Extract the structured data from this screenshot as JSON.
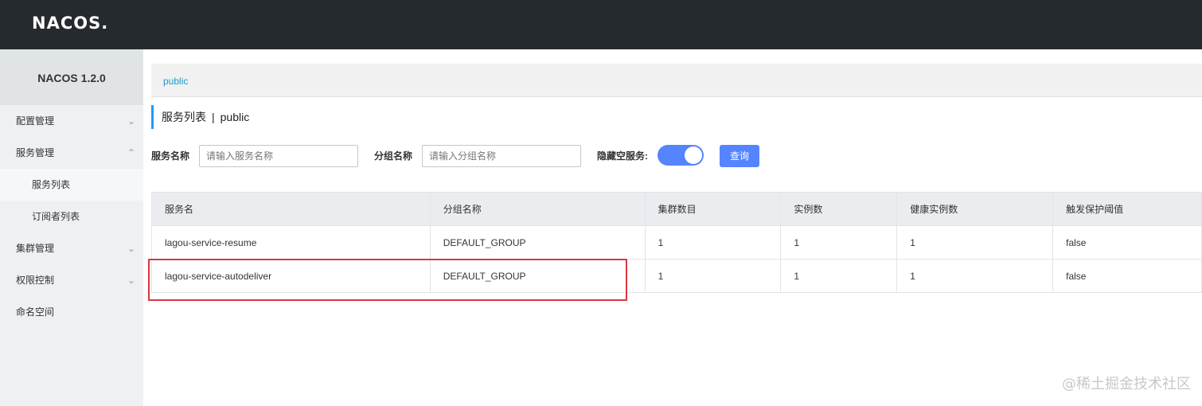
{
  "app": {
    "logo": "NACOS.",
    "version": "NACOS 1.2.0"
  },
  "sidebar": {
    "items": [
      {
        "label": "配置管理",
        "chevron": "chevron-down"
      },
      {
        "label": "服务管理",
        "chevron": "chevron-up"
      },
      {
        "label": "服务列表"
      },
      {
        "label": "订阅者列表"
      },
      {
        "label": "集群管理",
        "chevron": "chevron-down"
      },
      {
        "label": "权限控制",
        "chevron": "chevron-down"
      },
      {
        "label": "命名空间"
      }
    ]
  },
  "breadcrumb": {
    "namespace": "public"
  },
  "page": {
    "title": "服务列表",
    "separator": "|",
    "namespace": "public"
  },
  "filters": {
    "service_name_label": "服务名称",
    "service_name_placeholder": "请输入服务名称",
    "group_name_label": "分组名称",
    "group_name_placeholder": "请输入分组名称",
    "hide_empty_label": "隐藏空服务:",
    "hide_empty_on": true,
    "query_button": "查询"
  },
  "table": {
    "headers": [
      "服务名",
      "分组名称",
      "集群数目",
      "实例数",
      "健康实例数",
      "触发保护阈值"
    ],
    "rows": [
      [
        "lagou-service-resume",
        "DEFAULT_GROUP",
        "1",
        "1",
        "1",
        "false"
      ],
      [
        "lagou-service-autodeliver",
        "DEFAULT_GROUP",
        "1",
        "1",
        "1",
        "false"
      ]
    ]
  },
  "watermark": "@稀土掘金技术社区",
  "colors": {
    "topbar": "#252a2f",
    "accent": "#5584ff",
    "link": "#1b9bc9",
    "highlight": "#d9363e"
  }
}
